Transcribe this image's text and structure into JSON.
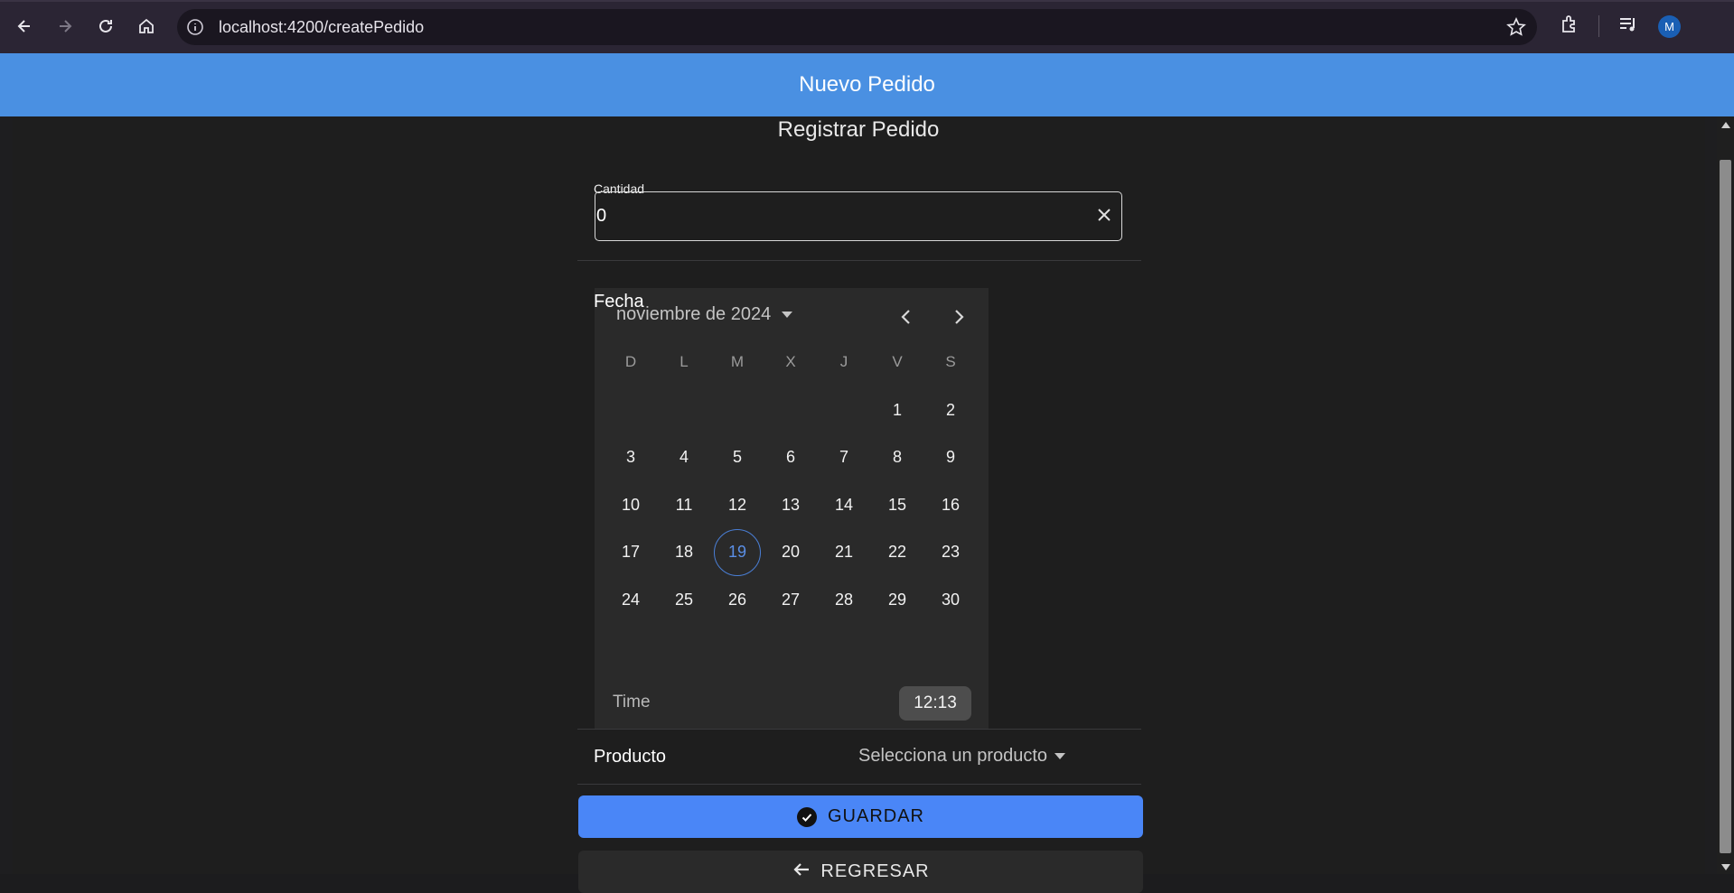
{
  "browser": {
    "url": "localhost:4200/createPedido",
    "avatar_initial": "M"
  },
  "header": {
    "title": "Nuevo Pedido"
  },
  "form": {
    "heading": "Registrar Pedido",
    "cantidad_label": "Cantidad",
    "cantidad_value": "0",
    "fecha_label": "Fecha",
    "producto_label": "Producto",
    "producto_placeholder": "Selecciona un producto",
    "save_label": "GUARDAR",
    "back_label": "REGRESAR"
  },
  "calendar": {
    "month_label": "noviembre de 2024",
    "weekdays": [
      "D",
      "L",
      "M",
      "X",
      "J",
      "V",
      "S"
    ],
    "weeks": [
      [
        "",
        "",
        "",
        "",
        "",
        "1",
        "2"
      ],
      [
        "3",
        "4",
        "5",
        "6",
        "7",
        "8",
        "9"
      ],
      [
        "10",
        "11",
        "12",
        "13",
        "14",
        "15",
        "16"
      ],
      [
        "17",
        "18",
        "19",
        "20",
        "21",
        "22",
        "23"
      ],
      [
        "24",
        "25",
        "26",
        "27",
        "28",
        "29",
        "30"
      ]
    ],
    "today": "19",
    "time_label": "Time",
    "time_value": "12:13"
  },
  "colors": {
    "header": "#4a90e2",
    "primary_button": "#4a86f7",
    "today_ring": "#4a7fd6"
  }
}
